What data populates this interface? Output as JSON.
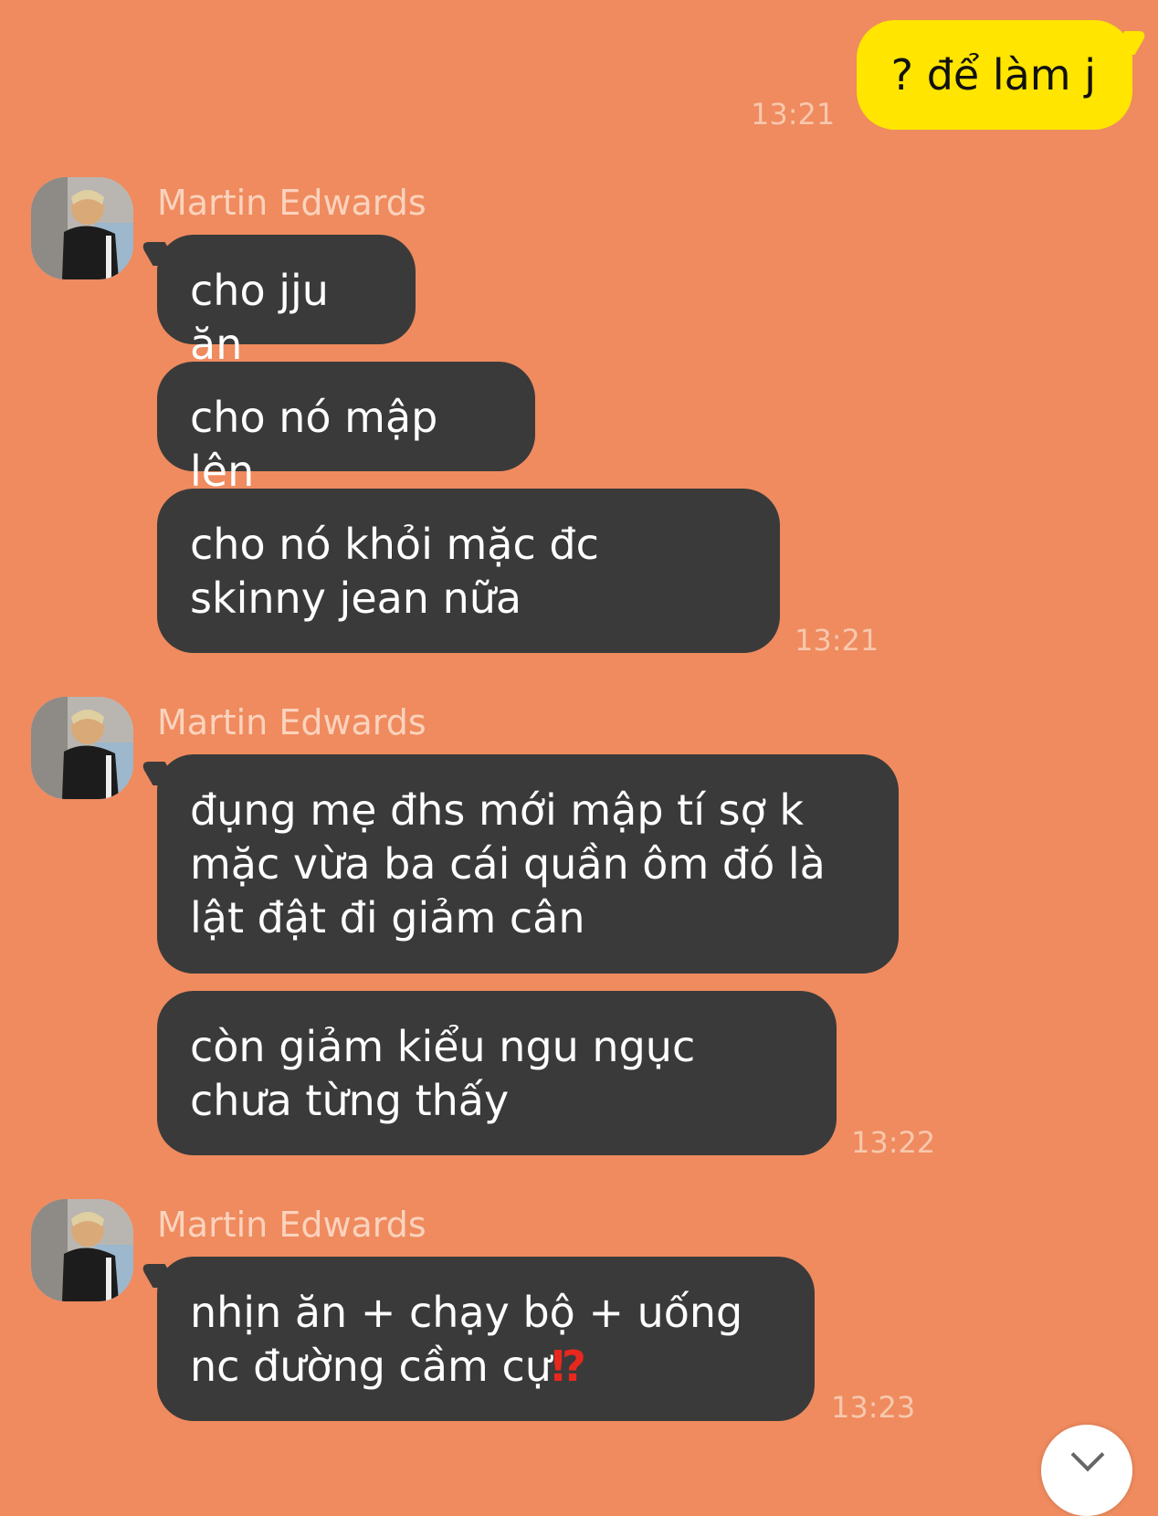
{
  "messages": {
    "outgoing": {
      "text": "? để làm j",
      "time": "13:21"
    },
    "groups": [
      {
        "sender": "Martin Edwards",
        "bubbles": [
          "cho jju ăn",
          "cho nó mập lên",
          "cho nó khỏi mặc đc skinny jean nữa"
        ],
        "time": "13:21"
      },
      {
        "sender": "Martin Edwards",
        "bubbles": [
          "đụng mẹ đhs mới mập tí sợ k mặc vừa ba cái quần ôm đó là lật đật đi giảm cân",
          "còn giảm kiểu ngu ngục chưa từng thấy"
        ],
        "time": "13:22"
      },
      {
        "sender": "Martin Edwards",
        "bubbles": [
          "nhịn ăn + chạy bộ + uống nc đường cầm cự"
        ],
        "emoji": "⁉",
        "time": "13:23"
      }
    ]
  },
  "icons": {
    "avatar": "user-avatar-photo",
    "scroll": "chevron-down-icon"
  }
}
